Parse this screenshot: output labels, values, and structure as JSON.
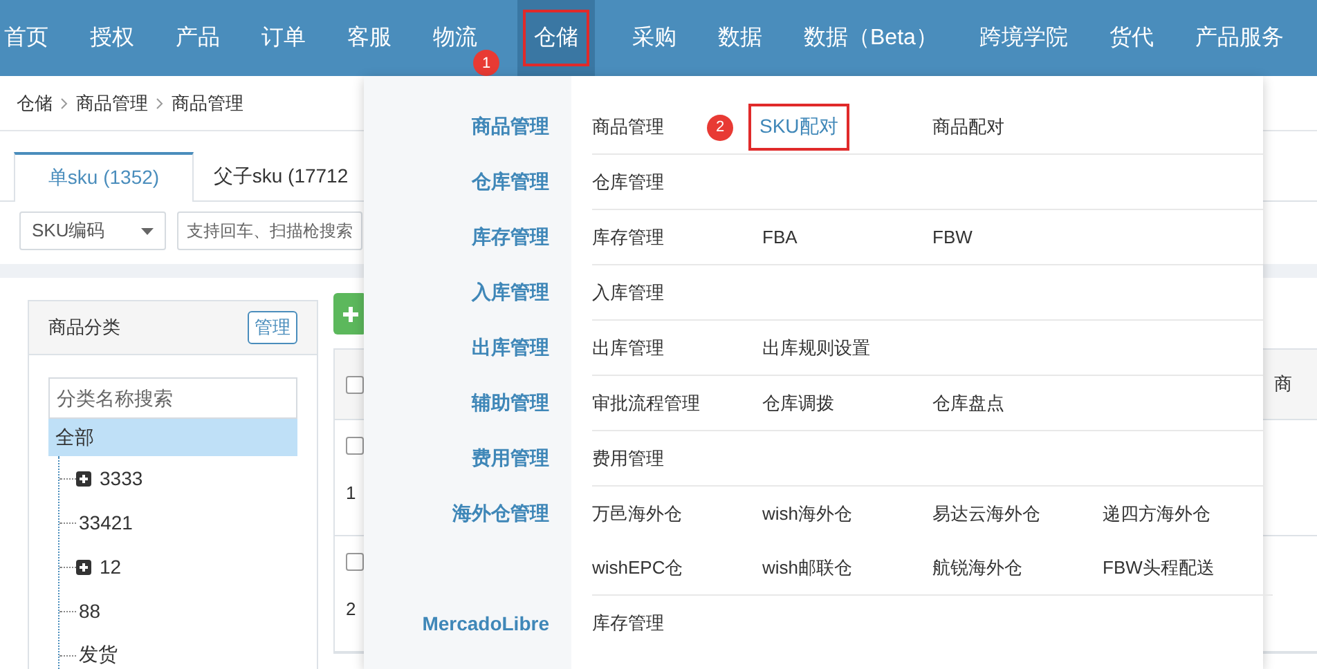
{
  "nav": {
    "items": [
      {
        "label": "首页",
        "selected": false
      },
      {
        "label": "授权",
        "selected": false
      },
      {
        "label": "产品",
        "selected": false
      },
      {
        "label": "订单",
        "selected": false
      },
      {
        "label": "客服",
        "selected": false
      },
      {
        "label": "物流",
        "selected": false
      },
      {
        "label": "仓储",
        "selected": true,
        "callout": "1"
      },
      {
        "label": "采购",
        "selected": false
      },
      {
        "label": "数据",
        "selected": false
      },
      {
        "label": "数据（Beta）",
        "selected": false
      },
      {
        "label": "跨境学院",
        "selected": false
      },
      {
        "label": "货代",
        "selected": false
      },
      {
        "label": "产品服务",
        "selected": false
      }
    ]
  },
  "breadcrumb": [
    "仓储",
    "商品管理",
    "商品管理"
  ],
  "tabs": [
    {
      "label": "单sku (1352)",
      "selected": true
    },
    {
      "label": "父子sku (17712",
      "selected": false
    }
  ],
  "filter": {
    "field_select": "SKU编码",
    "search": {
      "placeholder": "支持回车、扫描枪搜索"
    }
  },
  "category_panel": {
    "title": "商品分类",
    "manage_button": "管理",
    "search": {
      "placeholder": "分类名称搜索"
    },
    "tree": [
      {
        "label": "全部",
        "selected": true,
        "children": [
          {
            "label": "3333",
            "selected": false,
            "expandable": true
          },
          {
            "label": "33421",
            "selected": false,
            "expandable": false
          },
          {
            "label": "12",
            "selected": false,
            "expandable": true
          },
          {
            "label": "88",
            "selected": false,
            "expandable": false
          },
          {
            "label": "发货",
            "selected": false,
            "expandable": false
          }
        ]
      }
    ]
  },
  "table": {
    "header_checked": false,
    "column_2": "商",
    "rows": [
      {
        "column_1": "1",
        "checked": false
      },
      {
        "column_1": "2",
        "checked": false
      }
    ]
  },
  "menu": {
    "groups": [
      {
        "title": "商品管理",
        "rows": [
          [
            {
              "label": "商品管理",
              "selected": false
            },
            {
              "label": "SKU配对",
              "selected": true,
              "callout": "2"
            },
            {
              "label": "商品配对",
              "selected": false
            }
          ]
        ]
      },
      {
        "title": "仓库管理",
        "rows": [
          [
            {
              "label": "仓库管理",
              "selected": false
            }
          ]
        ]
      },
      {
        "title": "库存管理",
        "rows": [
          [
            {
              "label": "库存管理",
              "selected": false
            },
            {
              "label": "FBA",
              "selected": false
            },
            {
              "label": "FBW",
              "selected": false
            }
          ]
        ]
      },
      {
        "title": "入库管理",
        "rows": [
          [
            {
              "label": "入库管理",
              "selected": false
            }
          ]
        ]
      },
      {
        "title": "出库管理",
        "rows": [
          [
            {
              "label": "出库管理",
              "selected": false
            },
            {
              "label": "出库规则设置",
              "selected": false
            }
          ]
        ]
      },
      {
        "title": "辅助管理",
        "rows": [
          [
            {
              "label": "审批流程管理",
              "selected": false
            },
            {
              "label": "仓库调拨",
              "selected": false
            },
            {
              "label": "仓库盘点",
              "selected": false
            }
          ]
        ]
      },
      {
        "title": "费用管理",
        "rows": [
          [
            {
              "label": "费用管理",
              "selected": false
            }
          ]
        ]
      },
      {
        "title": "海外仓管理",
        "rows": [
          [
            {
              "label": "万邑海外仓",
              "selected": false
            },
            {
              "label": "wish海外仓",
              "selected": false
            },
            {
              "label": "易达云海外仓",
              "selected": false
            },
            {
              "label": "递四方海外仓",
              "selected": false
            }
          ],
          [
            {
              "label": "wishEPC仓",
              "selected": false
            },
            {
              "label": "wish邮联仓",
              "selected": false
            },
            {
              "label": "航锐海外仓",
              "selected": false
            },
            {
              "label": "FBW头程配送",
              "selected": false
            }
          ]
        ]
      },
      {
        "title": "MercadoLibre",
        "rows": [
          [
            {
              "label": "库存管理",
              "selected": false
            }
          ]
        ]
      }
    ]
  }
}
